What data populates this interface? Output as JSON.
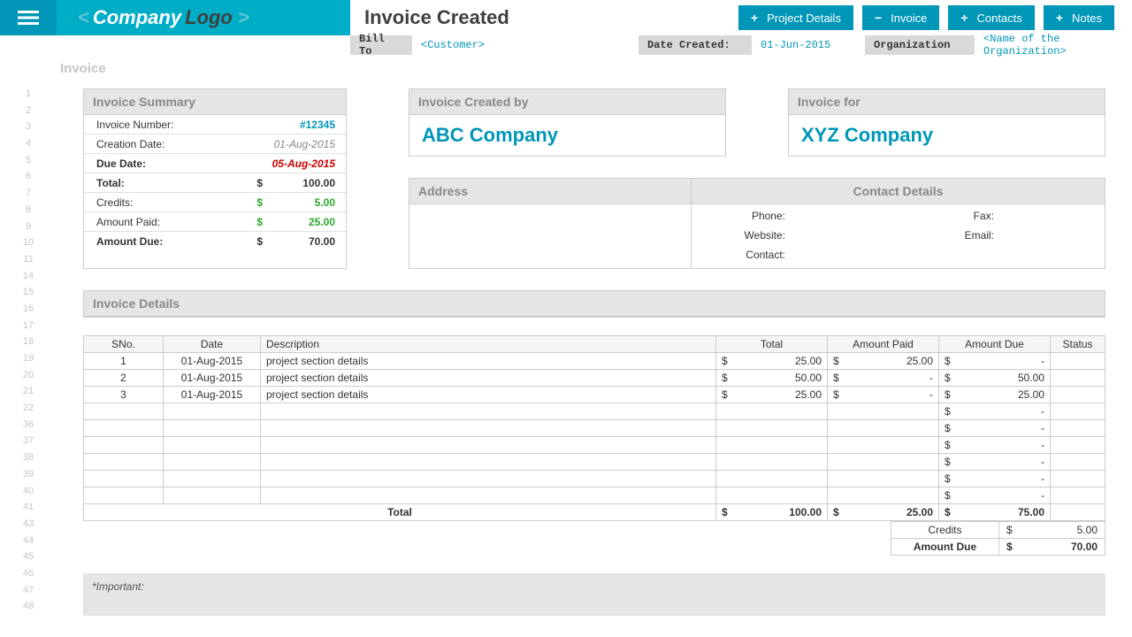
{
  "header": {
    "logo_company": "Company",
    "logo_logo": "Logo",
    "title": "Invoice Created",
    "buttons": [
      {
        "sym": "+",
        "label": "Project Details"
      },
      {
        "sym": "−",
        "label": "Invoice"
      },
      {
        "sym": "+",
        "label": "Contacts"
      },
      {
        "sym": "+",
        "label": "Notes"
      }
    ]
  },
  "meta": {
    "bill_to_label": "Bill To",
    "customer": "<Customer>",
    "date_label": "Date Created:",
    "date_value": "01-Jun-2015",
    "org_label": "Organization",
    "org_value": "<Name of the Organization>"
  },
  "sheet_tab": "Invoice",
  "rownums": [
    "1",
    "2",
    "3",
    "4",
    "5",
    "6",
    "7",
    "8",
    "9",
    "10",
    "11",
    "14",
    "15",
    "16",
    "17",
    "18",
    "19",
    "20",
    "21",
    "22",
    "36",
    "37",
    "38",
    "39",
    "40",
    "41",
    "43",
    "44",
    "45",
    "46",
    "47",
    "48"
  ],
  "summary": {
    "header": "Invoice Summary",
    "rows": [
      {
        "label": "Invoice Number:",
        "cur": "",
        "val": "#12345",
        "cls": "link"
      },
      {
        "label": "Creation Date:",
        "cur": "",
        "val": "01-Aug-2015",
        "cls": "ital"
      },
      {
        "label": "Due Date:",
        "cur": "",
        "val": "05-Aug-2015",
        "cls": "ital bold"
      },
      {
        "label": "Total:",
        "cur": "$",
        "val": "100.00",
        "cls": "bold"
      },
      {
        "label": "Credits:",
        "cur": "$",
        "val": "5.00",
        "cls": "green"
      },
      {
        "label": "Amount Paid:",
        "cur": "$",
        "val": "25.00",
        "cls": "green"
      },
      {
        "label": "Amount Due:",
        "cur": "$",
        "val": "70.00",
        "cls": "bold"
      }
    ]
  },
  "created_by": {
    "header": "Invoice Created by",
    "value": "ABC Company"
  },
  "invoice_for": {
    "header": "Invoice for",
    "value": "XYZ Company"
  },
  "address_header": "Address",
  "contact_details_header": "Contact Details",
  "contact_labels": {
    "phone": "Phone:",
    "fax": "Fax:",
    "website": "Website:",
    "email": "Email:",
    "contact": "Contact:"
  },
  "details": {
    "header": "Invoice Details",
    "columns": [
      "SNo.",
      "Date",
      "Description",
      "Total",
      "Amount Paid",
      "Amount Due",
      "Status"
    ],
    "rows": [
      {
        "sno": "1",
        "date": "01-Aug-2015",
        "desc": "project section details",
        "total": "25.00",
        "paid": "25.00",
        "due": "-"
      },
      {
        "sno": "2",
        "date": "01-Aug-2015",
        "desc": "project section details",
        "total": "50.00",
        "paid": "-",
        "due": "50.00"
      },
      {
        "sno": "3",
        "date": "01-Aug-2015",
        "desc": "project section details",
        "total": "25.00",
        "paid": "-",
        "due": "25.00"
      }
    ],
    "empty_count": 6,
    "total_row": {
      "label": "Total",
      "total": "100.00",
      "paid": "25.00",
      "due": "75.00"
    }
  },
  "bottom": {
    "credits_label": "Credits",
    "credits_val": "5.00",
    "due_label": "Amount Due",
    "due_val": "70.00"
  },
  "important": "*Important:"
}
